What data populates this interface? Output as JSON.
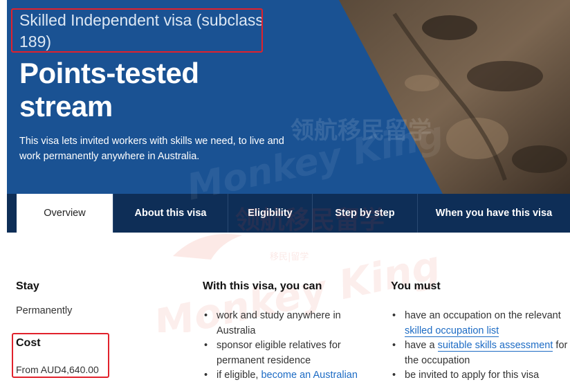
{
  "hero": {
    "subtitle": "Skilled Independent visa (subclass 189)",
    "title_line1": "Points-tested",
    "title_line2": "stream",
    "description": "This visa lets invited workers with skills we need, to live and work permanently anywhere in Australia."
  },
  "tabs": [
    {
      "label": "Overview",
      "active": true
    },
    {
      "label": "About this visa",
      "active": false
    },
    {
      "label": "Eligibility",
      "active": false
    },
    {
      "label": "Step by step",
      "active": false
    },
    {
      "label": "When you have this visa",
      "active": false
    }
  ],
  "stay": {
    "heading": "Stay",
    "value": "Permanently"
  },
  "cost": {
    "heading": "Cost",
    "value": "From AUD4,640.00"
  },
  "with_visa": {
    "heading": "With this visa, you can",
    "items": [
      {
        "text": "work and study anywhere in Australia"
      },
      {
        "text": "sponsor eligible relatives for permanent residence"
      },
      {
        "prefix": "if eligible, ",
        "link": "become an Australian"
      }
    ]
  },
  "you_must": {
    "heading": "You must",
    "items": [
      {
        "prefix": "have an occupation on the relevant ",
        "link": "skilled occupation list",
        "suffix": ""
      },
      {
        "prefix": "have a ",
        "link": "suitable skills assessment",
        "suffix": " for the occupation"
      },
      {
        "prefix": "be invited to apply for this visa",
        "link": "",
        "suffix": ""
      }
    ]
  },
  "watermark": {
    "brand": "Monkey King",
    "cn": "领航移民留学",
    "cn_small": "移民|留学"
  },
  "colors": {
    "hero_blue": "#1a5293",
    "tab_navy": "#0e2e57",
    "link": "#1c6bc4",
    "highlight": "#e1212b"
  }
}
